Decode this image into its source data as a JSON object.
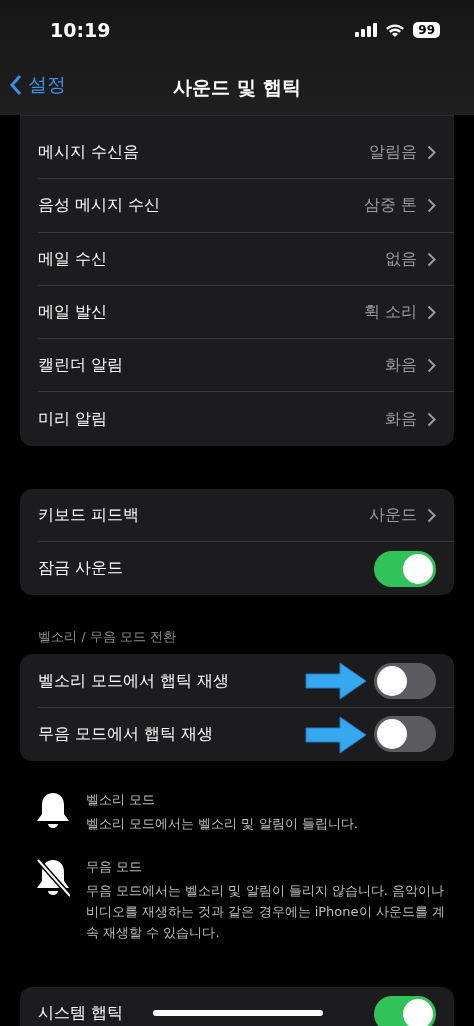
{
  "status_bar": {
    "time": "10:19",
    "battery": "99"
  },
  "nav": {
    "back": "설정",
    "title": "사운드 및 햅틱"
  },
  "groups": [
    {
      "cut_top": true,
      "rows": [
        {
          "kind": "link",
          "label": "메시지 수신음",
          "value": "알림음",
          "annotated": false
        },
        {
          "kind": "link",
          "label": "음성 메시지 수신",
          "value": "삼중 톤",
          "annotated": false
        },
        {
          "kind": "link",
          "label": "메일 수신",
          "value": "없음",
          "annotated": false
        },
        {
          "kind": "link",
          "label": "메일 발신",
          "value": "휙 소리",
          "annotated": false
        },
        {
          "kind": "link",
          "label": "캘린더 알림",
          "value": "화음",
          "annotated": false
        },
        {
          "kind": "link",
          "label": "미리 알림",
          "value": "화음",
          "annotated": false
        }
      ]
    },
    {
      "cut_top": false,
      "rows": [
        {
          "kind": "link",
          "label": "키보드 피드백",
          "value": "사운드",
          "annotated": false
        },
        {
          "kind": "toggle",
          "label": "잠금 사운드",
          "on": true,
          "annotated": false
        }
      ]
    },
    {
      "cut_top": false,
      "header": "벨소리 / 무음 모드 전환",
      "rows": [
        {
          "kind": "toggle",
          "label": "벨소리 모드에서 햅틱 재생",
          "on": false,
          "annotated": true
        },
        {
          "kind": "toggle",
          "label": "무음 모드에서 햅틱 재생",
          "on": false,
          "annotated": true
        }
      ]
    }
  ],
  "info": [
    {
      "kind": "ring",
      "title": "벨소리 모드",
      "text": "벨소리 모드에서는 벨소리 및 알림이 들립니다."
    },
    {
      "kind": "silent",
      "title": "무음 모드",
      "text": "무음 모드에서는 벨소리 및 알림이 들리지 않습니다. 음악이나 비디오를 재생하는 것과 같은 경우에는 iPhone이 사운드를 계속 재생할 수 있습니다."
    }
  ],
  "bottom_group": {
    "rows": [
      {
        "kind": "toggle",
        "label": "시스템 햅틱",
        "on": true,
        "annotated": false
      }
    ]
  }
}
